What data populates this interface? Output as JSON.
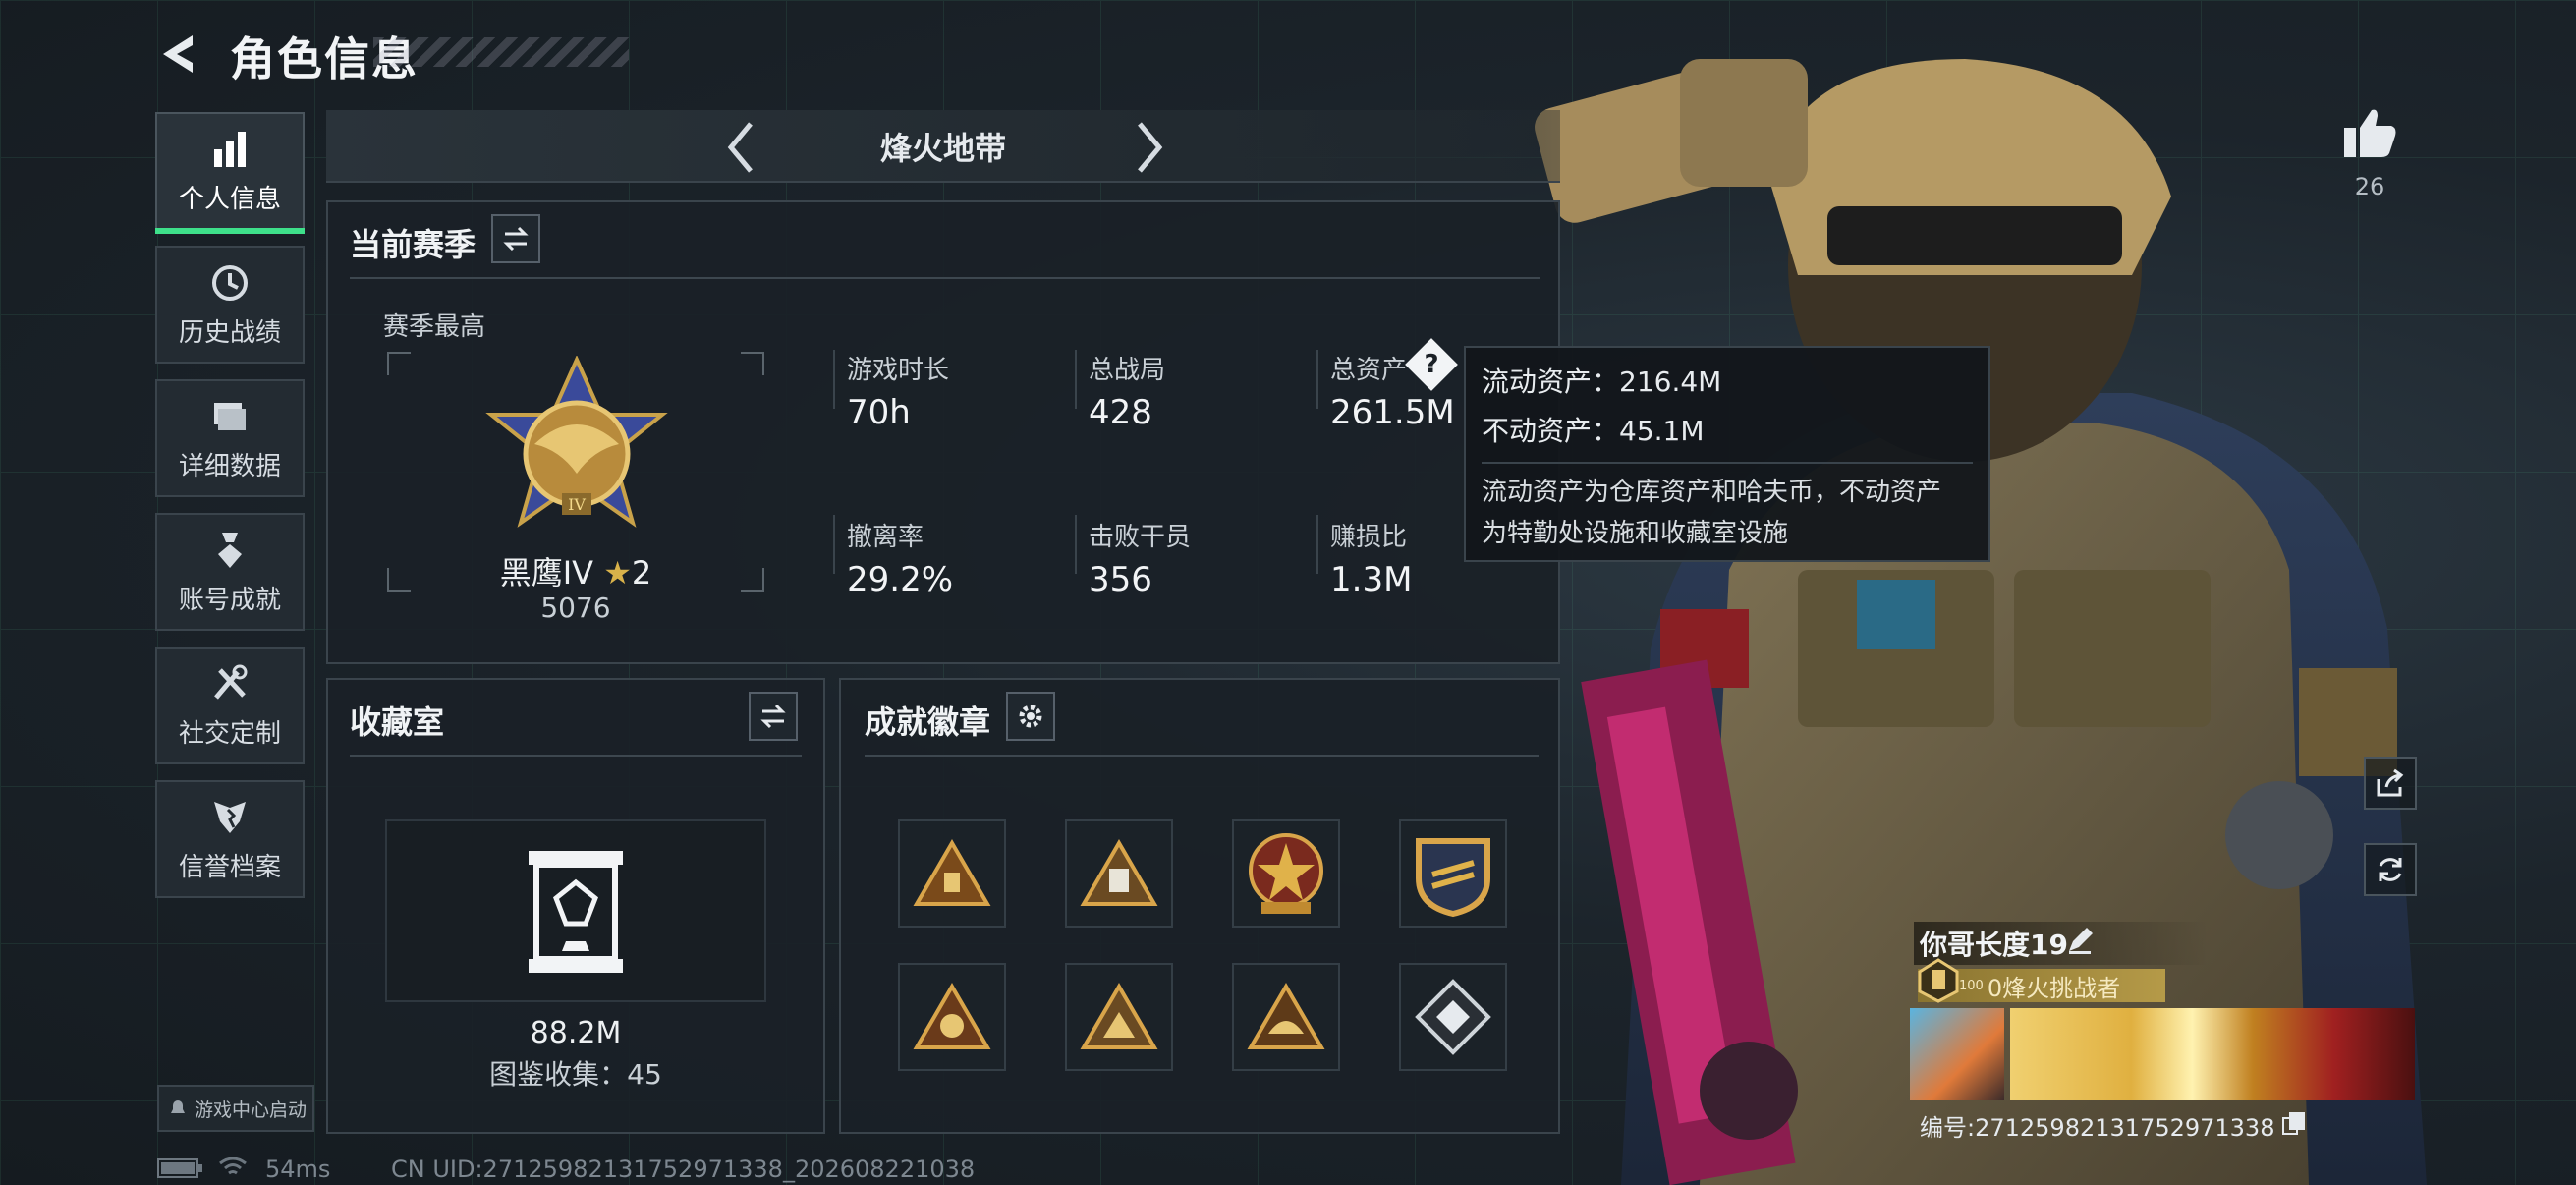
{
  "header": {
    "title": "角色信息"
  },
  "sidebar": {
    "items": [
      {
        "label": "个人信息",
        "icon": "bar-chart-icon",
        "active": true
      },
      {
        "label": "历史战绩",
        "icon": "history-icon"
      },
      {
        "label": "详细数据",
        "icon": "folder-icon"
      },
      {
        "label": "账号成就",
        "icon": "medal-icon"
      },
      {
        "label": "社交定制",
        "icon": "tools-icon"
      },
      {
        "label": "信誉档案",
        "icon": "shield-icon"
      }
    ],
    "launch_label": "游戏中心启动"
  },
  "mode_selector": {
    "label": "烽火地带"
  },
  "season": {
    "title": "当前赛季",
    "best_label": "赛季最高",
    "rank_name": "黑鹰IV",
    "rank_stars": "2",
    "rank_score": "5076",
    "stats": [
      {
        "label": "游戏时长",
        "value": "70h"
      },
      {
        "label": "总战局",
        "value": "428"
      },
      {
        "label": "总资产",
        "value": "261.5M"
      },
      {
        "label": "撤离率",
        "value": "29.2%"
      },
      {
        "label": "击败干员",
        "value": "356"
      },
      {
        "label": "赚损比",
        "value": "1.3M"
      }
    ]
  },
  "tooltip": {
    "liquid": "流动资产：216.4M",
    "fixed": "不动资产：45.1M",
    "desc1": "流动资产为仓库资产和哈夫币，不动资产",
    "desc2": "为特勤处设施和收藏室设施"
  },
  "collection": {
    "title": "收藏室",
    "value": "88.2M",
    "catalog": "图鉴收集：45"
  },
  "achievements": {
    "title": "成就徽章",
    "badges": [
      "badge-1",
      "badge-2",
      "badge-3",
      "badge-4",
      "badge-5",
      "badge-6",
      "badge-7",
      "badge-8"
    ]
  },
  "player": {
    "name": "你哥长度19",
    "level": "100",
    "title_tag": "0烽火挑战者",
    "id_line": "编号:27125982131752971338"
  },
  "likes": {
    "count": "26"
  },
  "status_bar": {
    "ping": "54ms",
    "uid": "CN UID:27125982131752971338_202608221038"
  },
  "colors": {
    "accent": "#3ee08a",
    "gold": "#c9a24a",
    "panel": "#1a2127"
  }
}
